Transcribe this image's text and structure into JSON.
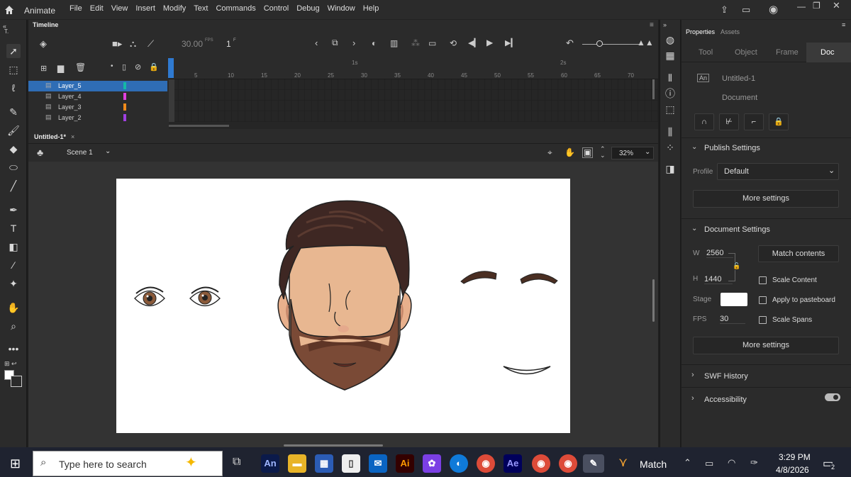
{
  "menubar": {
    "app_name": "Animate",
    "items": [
      "File",
      "Edit",
      "View",
      "Insert",
      "Modify",
      "Text",
      "Commands",
      "Control",
      "Debug",
      "Window",
      "Help"
    ]
  },
  "timeline": {
    "tab_label": "Timeline",
    "fps": "30.00",
    "fps_unit": "FPS",
    "frame": "1",
    "frame_unit": "F",
    "ruler_ticks": [
      "5",
      "10",
      "15",
      "20",
      "25",
      "30",
      "35",
      "40",
      "45",
      "50",
      "55",
      "60",
      "65",
      "70"
    ],
    "ruler_seconds": [
      "1s",
      "2s"
    ],
    "layers": [
      {
        "name": "Layer_5",
        "color": "#14b8a6",
        "selected": true
      },
      {
        "name": "Layer_4",
        "color": "#e040e0",
        "selected": false
      },
      {
        "name": "Layer_3",
        "color": "#f08a1c",
        "selected": false
      },
      {
        "name": "Layer_2",
        "color": "#a040e0",
        "selected": false
      }
    ]
  },
  "document": {
    "tab": "Untitled-1*",
    "scene": "Scene 1",
    "zoom": "32%"
  },
  "properties": {
    "tabs": [
      "Properties",
      "Assets"
    ],
    "subtabs": [
      "Tool",
      "Object",
      "Frame",
      "Doc"
    ],
    "doc_name": "Untitled-1",
    "doc_type": "Document",
    "publish_settings": {
      "title": "Publish Settings",
      "profile_label": "Profile",
      "profile_value": "Default",
      "more": "More settings"
    },
    "document_settings": {
      "title": "Document Settings",
      "w_label": "W",
      "w_value": "2560",
      "h_label": "H",
      "h_value": "1440",
      "match": "Match contents",
      "scale_content": "Scale Content",
      "apply_pasteboard": "Apply to pasteboard",
      "scale_spans": "Scale Spans",
      "stage_label": "Stage",
      "fps_label": "FPS",
      "fps_value": "30",
      "more": "More settings"
    },
    "swf_history": "SWF History",
    "accessibility": "Accessibility"
  },
  "taskbar": {
    "search_placeholder": "Type here to search",
    "app_label": "Match",
    "time": "3:29 PM",
    "date": "4/8/2026",
    "notifications": "2",
    "an": "An",
    "ai": "Ai",
    "ae": "Ae"
  },
  "colors": {
    "accent": "#2f6db5",
    "stage_bg": "#ffffff"
  }
}
